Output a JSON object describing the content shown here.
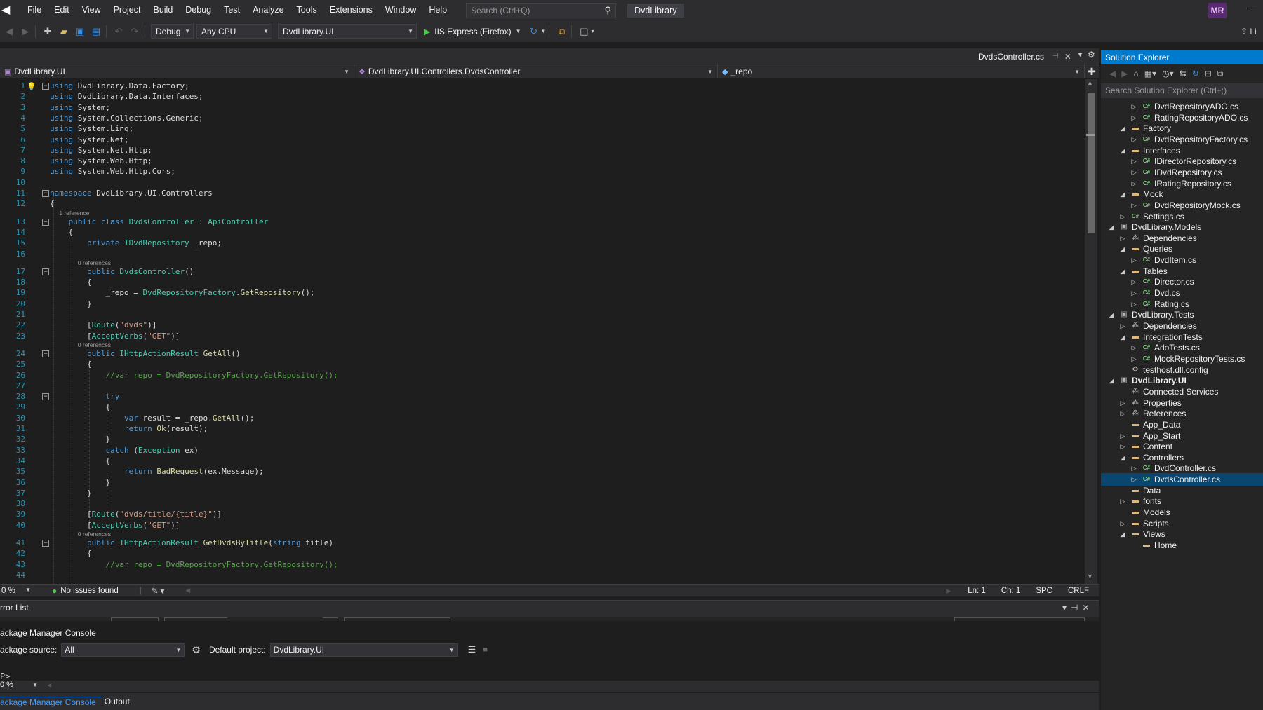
{
  "menubar": {
    "items": [
      "File",
      "Edit",
      "View",
      "Project",
      "Build",
      "Debug",
      "Test",
      "Analyze",
      "Tools",
      "Extensions",
      "Window",
      "Help"
    ],
    "search_placeholder": "Search (Ctrl+Q)",
    "solution_name": "DvdLibrary",
    "user_initials": "MR"
  },
  "toolbar": {
    "configuration": "Debug",
    "platform": "Any CPU",
    "startup_project": "DvdLibrary.UI",
    "run_target": "IIS Express (Firefox)",
    "live_share": "Li"
  },
  "document_tab": {
    "label": "DvdsController.cs"
  },
  "navbar": {
    "project": "DvdLibrary.UI",
    "type": "DvdLibrary.UI.Controllers.DvdsController",
    "member": "_repo"
  },
  "editor": {
    "lines": [
      {
        "n": "1",
        "parts": [
          [
            "kw",
            "using"
          ],
          [
            "id",
            " DvdLibrary.Data.Factory;"
          ]
        ]
      },
      {
        "n": "2",
        "parts": [
          [
            "kw",
            "using"
          ],
          [
            "id",
            " DvdLibrary.Data.Interfaces;"
          ]
        ]
      },
      {
        "n": "3",
        "parts": [
          [
            "kw",
            "using"
          ],
          [
            "id",
            " System;"
          ]
        ]
      },
      {
        "n": "4",
        "parts": [
          [
            "kw",
            "using"
          ],
          [
            "id",
            " System.Collections.Generic;"
          ]
        ]
      },
      {
        "n": "5",
        "parts": [
          [
            "kw",
            "using"
          ],
          [
            "id",
            " System.Linq;"
          ]
        ]
      },
      {
        "n": "6",
        "parts": [
          [
            "kw",
            "using"
          ],
          [
            "id",
            " System.Net;"
          ]
        ]
      },
      {
        "n": "7",
        "parts": [
          [
            "kw",
            "using"
          ],
          [
            "id",
            " System.Net.Http;"
          ]
        ]
      },
      {
        "n": "8",
        "parts": [
          [
            "kw",
            "using"
          ],
          [
            "id",
            " System.Web.Http;"
          ]
        ]
      },
      {
        "n": "9",
        "parts": [
          [
            "kw",
            "using"
          ],
          [
            "id",
            " System.Web.Http.Cors;"
          ]
        ]
      },
      {
        "n": "10",
        "parts": []
      },
      {
        "n": "11",
        "parts": [
          [
            "kw",
            "namespace"
          ],
          [
            "id",
            " DvdLibrary.UI.Controllers"
          ]
        ]
      },
      {
        "n": "12",
        "parts": [
          [
            "id",
            "{"
          ]
        ]
      },
      {
        "n": "13",
        "ref": "1 reference",
        "parts": [
          [
            "id",
            "    "
          ],
          [
            "kw",
            "public class"
          ],
          [
            "id",
            " "
          ],
          [
            "ty",
            "DvdsController"
          ],
          [
            "id",
            " : "
          ],
          [
            "ty",
            "ApiController"
          ]
        ]
      },
      {
        "n": "14",
        "parts": [
          [
            "id",
            "    {"
          ]
        ]
      },
      {
        "n": "15",
        "parts": [
          [
            "id",
            "        "
          ],
          [
            "kw",
            "private"
          ],
          [
            "id",
            " "
          ],
          [
            "ty",
            "IDvdRepository"
          ],
          [
            "id",
            " _repo;"
          ]
        ]
      },
      {
        "n": "16",
        "parts": []
      },
      {
        "n": "17",
        "ref": "0 references",
        "parts": [
          [
            "id",
            "        "
          ],
          [
            "kw",
            "public"
          ],
          [
            "id",
            " "
          ],
          [
            "ty",
            "DvdsController"
          ],
          [
            "id",
            "()"
          ]
        ]
      },
      {
        "n": "18",
        "parts": [
          [
            "id",
            "        {"
          ]
        ]
      },
      {
        "n": "19",
        "parts": [
          [
            "id",
            "            _repo = "
          ],
          [
            "ty",
            "DvdRepositoryFactory"
          ],
          [
            "id",
            "."
          ],
          [
            "fn",
            "GetRepository"
          ],
          [
            "id",
            "();"
          ]
        ]
      },
      {
        "n": "20",
        "parts": [
          [
            "id",
            "        }"
          ]
        ]
      },
      {
        "n": "21",
        "parts": []
      },
      {
        "n": "22",
        "parts": [
          [
            "id",
            "        ["
          ],
          [
            "ty",
            "Route"
          ],
          [
            "id",
            "("
          ],
          [
            "st",
            "\"dvds\""
          ],
          [
            "id",
            ")]"
          ]
        ]
      },
      {
        "n": "23",
        "parts": [
          [
            "id",
            "        ["
          ],
          [
            "ty",
            "AcceptVerbs"
          ],
          [
            "id",
            "("
          ],
          [
            "st",
            "\"GET\""
          ],
          [
            "id",
            ")]"
          ]
        ]
      },
      {
        "n": "24",
        "ref": "0 references",
        "parts": [
          [
            "id",
            "        "
          ],
          [
            "kw",
            "public"
          ],
          [
            "id",
            " "
          ],
          [
            "ty",
            "IHttpActionResult"
          ],
          [
            "id",
            " "
          ],
          [
            "fn",
            "GetAll"
          ],
          [
            "id",
            "()"
          ]
        ]
      },
      {
        "n": "25",
        "parts": [
          [
            "id",
            "        {"
          ]
        ]
      },
      {
        "n": "26",
        "parts": [
          [
            "id",
            "            "
          ],
          [
            "cm",
            "//var repo = DvdRepositoryFactory.GetRepository();"
          ]
        ]
      },
      {
        "n": "27",
        "parts": []
      },
      {
        "n": "28",
        "parts": [
          [
            "id",
            "            "
          ],
          [
            "kw",
            "try"
          ]
        ]
      },
      {
        "n": "29",
        "parts": [
          [
            "id",
            "            {"
          ]
        ]
      },
      {
        "n": "30",
        "parts": [
          [
            "id",
            "                "
          ],
          [
            "kw",
            "var"
          ],
          [
            "id",
            " result = _repo."
          ],
          [
            "fn",
            "GetAll"
          ],
          [
            "id",
            "();"
          ]
        ]
      },
      {
        "n": "31",
        "parts": [
          [
            "id",
            "                "
          ],
          [
            "kw",
            "return"
          ],
          [
            "id",
            " "
          ],
          [
            "fn",
            "Ok"
          ],
          [
            "id",
            "(result);"
          ]
        ]
      },
      {
        "n": "32",
        "parts": [
          [
            "id",
            "            }"
          ]
        ]
      },
      {
        "n": "33",
        "parts": [
          [
            "id",
            "            "
          ],
          [
            "kw",
            "catch"
          ],
          [
            "id",
            " ("
          ],
          [
            "ty",
            "Exception"
          ],
          [
            "id",
            " ex)"
          ]
        ]
      },
      {
        "n": "34",
        "parts": [
          [
            "id",
            "            {"
          ]
        ]
      },
      {
        "n": "35",
        "parts": [
          [
            "id",
            "                "
          ],
          [
            "kw",
            "return"
          ],
          [
            "id",
            " "
          ],
          [
            "fn",
            "BadRequest"
          ],
          [
            "id",
            "(ex.Message);"
          ]
        ]
      },
      {
        "n": "36",
        "parts": [
          [
            "id",
            "            }"
          ]
        ]
      },
      {
        "n": "37",
        "parts": [
          [
            "id",
            "        }"
          ]
        ]
      },
      {
        "n": "38",
        "parts": []
      },
      {
        "n": "39",
        "parts": [
          [
            "id",
            "        ["
          ],
          [
            "ty",
            "Route"
          ],
          [
            "id",
            "("
          ],
          [
            "st",
            "\"dvds/title/{title}\""
          ],
          [
            "id",
            ")]"
          ]
        ]
      },
      {
        "n": "40",
        "parts": [
          [
            "id",
            "        ["
          ],
          [
            "ty",
            "AcceptVerbs"
          ],
          [
            "id",
            "("
          ],
          [
            "st",
            "\"GET\""
          ],
          [
            "id",
            ")]"
          ]
        ]
      },
      {
        "n": "41",
        "ref": "0 references",
        "parts": [
          [
            "id",
            "        "
          ],
          [
            "kw",
            "public"
          ],
          [
            "id",
            " "
          ],
          [
            "ty",
            "IHttpActionResult"
          ],
          [
            "id",
            " "
          ],
          [
            "fn",
            "GetDvdsByTitle"
          ],
          [
            "id",
            "("
          ],
          [
            "kw",
            "string"
          ],
          [
            "id",
            " title)"
          ]
        ]
      },
      {
        "n": "42",
        "parts": [
          [
            "id",
            "        {"
          ]
        ]
      },
      {
        "n": "43",
        "parts": [
          [
            "id",
            "            "
          ],
          [
            "cm",
            "//var repo = DvdRepositoryFactory.GetRepository();"
          ]
        ]
      },
      {
        "n": "44",
        "parts": []
      }
    ]
  },
  "statusbar": {
    "zoom": "0 %",
    "issues": "No issues found",
    "line": "Ln: 1",
    "col": "Ch: 1",
    "spacing": "SPC",
    "line_ending": "CRLF"
  },
  "error_list": {
    "title": "rror List"
  },
  "package_manager": {
    "title": "ackage Manager Console",
    "source_label": "ackage source:",
    "source_value": "All",
    "default_project_label": "Default project:",
    "default_project_value": "DvdLibrary.UI",
    "prompt": "P>",
    "zoom": "0 %"
  },
  "bottom_tabs": [
    "ackage Manager Console",
    "Output"
  ],
  "solution_explorer": {
    "title": "Solution Explorer",
    "search_placeholder": "Search Solution Explorer (Ctrl+;)",
    "nodes": [
      {
        "label": "DvdRepositoryADO.cs",
        "depth": 3,
        "exp": "▷",
        "icon": "cs"
      },
      {
        "label": "RatingRepositoryADO.cs",
        "depth": 3,
        "exp": "▷",
        "icon": "cs"
      },
      {
        "label": "Factory",
        "depth": 2,
        "exp": "◢",
        "icon": "folder"
      },
      {
        "label": "DvdRepositoryFactory.cs",
        "depth": 3,
        "exp": "▷",
        "icon": "cs"
      },
      {
        "label": "Interfaces",
        "depth": 2,
        "exp": "◢",
        "icon": "folder"
      },
      {
        "label": "IDirectorRepository.cs",
        "depth": 3,
        "exp": "▷",
        "icon": "cs"
      },
      {
        "label": "IDvdRepository.cs",
        "depth": 3,
        "exp": "▷",
        "icon": "cs"
      },
      {
        "label": "IRatingRepository.cs",
        "depth": 3,
        "exp": "▷",
        "icon": "cs"
      },
      {
        "label": "Mock",
        "depth": 2,
        "exp": "◢",
        "icon": "folder"
      },
      {
        "label": "DvdRepositoryMock.cs",
        "depth": 3,
        "exp": "▷",
        "icon": "cs"
      },
      {
        "label": "Settings.cs",
        "depth": 2,
        "exp": "▷",
        "icon": "cs"
      },
      {
        "label": "DvdLibrary.Models",
        "depth": 1,
        "exp": "◢",
        "icon": "proj"
      },
      {
        "label": "Dependencies",
        "depth": 2,
        "exp": "▷",
        "icon": "dep"
      },
      {
        "label": "Queries",
        "depth": 2,
        "exp": "◢",
        "icon": "folder"
      },
      {
        "label": "DvdItem.cs",
        "depth": 3,
        "exp": "▷",
        "icon": "cs"
      },
      {
        "label": "Tables",
        "depth": 2,
        "exp": "◢",
        "icon": "folder"
      },
      {
        "label": "Director.cs",
        "depth": 3,
        "exp": "▷",
        "icon": "cs"
      },
      {
        "label": "Dvd.cs",
        "depth": 3,
        "exp": "▷",
        "icon": "cs"
      },
      {
        "label": "Rating.cs",
        "depth": 3,
        "exp": "▷",
        "icon": "cs"
      },
      {
        "label": "DvdLibrary.Tests",
        "depth": 1,
        "exp": "◢",
        "icon": "proj"
      },
      {
        "label": "Dependencies",
        "depth": 2,
        "exp": "▷",
        "icon": "dep"
      },
      {
        "label": "IntegrationTests",
        "depth": 2,
        "exp": "◢",
        "icon": "folder"
      },
      {
        "label": "AdoTests.cs",
        "depth": 3,
        "exp": "▷",
        "icon": "cs"
      },
      {
        "label": "MockRepositoryTests.cs",
        "depth": 3,
        "exp": "▷",
        "icon": "cs"
      },
      {
        "label": "testhost.dll.config",
        "depth": 2,
        "exp": "",
        "icon": "cfg"
      },
      {
        "label": "DvdLibrary.UI",
        "depth": 1,
        "exp": "◢",
        "icon": "proj",
        "bold": true
      },
      {
        "label": "Connected Services",
        "depth": 2,
        "exp": "",
        "icon": "dep"
      },
      {
        "label": "Properties",
        "depth": 2,
        "exp": "▷",
        "icon": "dep"
      },
      {
        "label": "References",
        "depth": 2,
        "exp": "▷",
        "icon": "dep"
      },
      {
        "label": "App_Data",
        "depth": 2,
        "exp": "",
        "icon": "folder"
      },
      {
        "label": "App_Start",
        "depth": 2,
        "exp": "▷",
        "icon": "folder"
      },
      {
        "label": "Content",
        "depth": 2,
        "exp": "▷",
        "icon": "folder"
      },
      {
        "label": "Controllers",
        "depth": 2,
        "exp": "◢",
        "icon": "folder"
      },
      {
        "label": "DvdController.cs",
        "depth": 3,
        "exp": "▷",
        "icon": "cs"
      },
      {
        "label": "DvdsController.cs",
        "depth": 3,
        "exp": "▷",
        "icon": "cs",
        "selected": true
      },
      {
        "label": "Data",
        "depth": 2,
        "exp": "",
        "icon": "folder"
      },
      {
        "label": "fonts",
        "depth": 2,
        "exp": "▷",
        "icon": "folder"
      },
      {
        "label": "Models",
        "depth": 2,
        "exp": "",
        "icon": "folder"
      },
      {
        "label": "Scripts",
        "depth": 2,
        "exp": "▷",
        "icon": "folder"
      },
      {
        "label": "Views",
        "depth": 2,
        "exp": "◢",
        "icon": "folder"
      },
      {
        "label": "Home",
        "depth": 3,
        "exp": "",
        "icon": "folder"
      }
    ]
  }
}
